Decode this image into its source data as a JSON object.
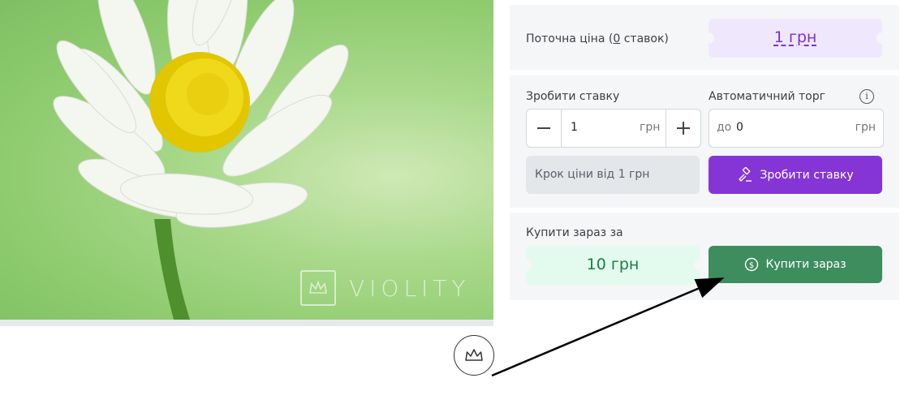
{
  "watermark": {
    "text": "VIOLITY"
  },
  "current_price": {
    "label_before": "Поточна ціна (",
    "bid_count": "0",
    "label_after": " ставок)",
    "value": "1 грн"
  },
  "bid": {
    "label": "Зробити ставку",
    "value": "1",
    "unit": "грн",
    "minus": "—",
    "plus": "+",
    "step_hint": "Крок ціни від 1 грн",
    "button": "Зробити ставку",
    "button_icon": "gavel-icon"
  },
  "auto_bid": {
    "label": "Автоматичний торг",
    "prefix": "до",
    "value": "0",
    "unit": "грн",
    "info": "i"
  },
  "buy_now": {
    "label": "Купити зараз за",
    "price": "10 грн",
    "button": "Купити зараз",
    "button_icon": "dollar-coin-icon"
  },
  "colors": {
    "bid_purple": "#8535d6",
    "buy_green": "#3e8d5f",
    "price_purple": "#7b30d6"
  }
}
